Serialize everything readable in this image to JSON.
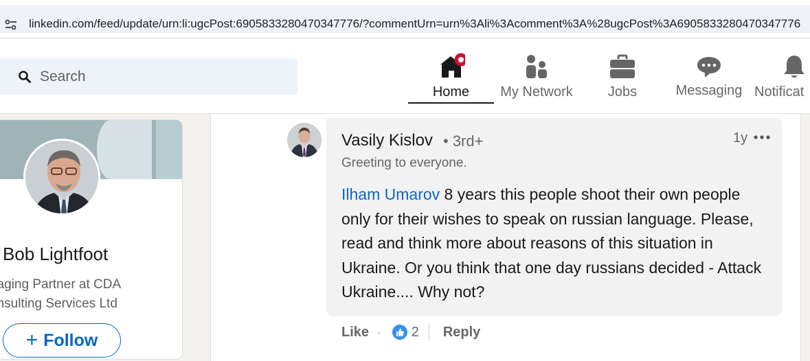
{
  "browser": {
    "url": "linkedin.com/feed/update/urn:li:ugcPost:6905833280470347776/?commentUrn=urn%3Ali%3Acomment%3A%28ugcPost%3A6905833280470347776"
  },
  "header": {
    "search_placeholder": "Search",
    "nav": [
      {
        "label": "Home",
        "icon": "home-icon",
        "active": true
      },
      {
        "label": "My Network",
        "icon": "people-icon"
      },
      {
        "label": "Jobs",
        "icon": "briefcase-icon"
      },
      {
        "label": "Messaging",
        "icon": "chat-icon"
      },
      {
        "label": "Notificat",
        "icon": "bell-icon"
      }
    ]
  },
  "profile": {
    "name": "Bob Lightfoot",
    "headline": "naging Partner at CDA onsulting Services Ltd",
    "follow_label": "Follow"
  },
  "comment": {
    "author": "Vasily Kislov",
    "degree": "• 3rd+",
    "author_headline": "Greeting to everyone.",
    "time_ago": "1y",
    "mention": "Ilham Umarov",
    "text": " 8 years this people shoot their own people only for their wishes to speak on russian language. Please, read and think more about reasons of this situation in Ukraine. Or you think that one day russians decided - Attack Ukraine.... Why not?",
    "actions": {
      "like_label": "Like",
      "separator": "·",
      "reaction_count": "2",
      "reply_label": "Reply"
    }
  },
  "colors": {
    "brand_blue": "#0a66c2",
    "notification_red": "#cb112d",
    "like_blue": "#378fe9"
  }
}
